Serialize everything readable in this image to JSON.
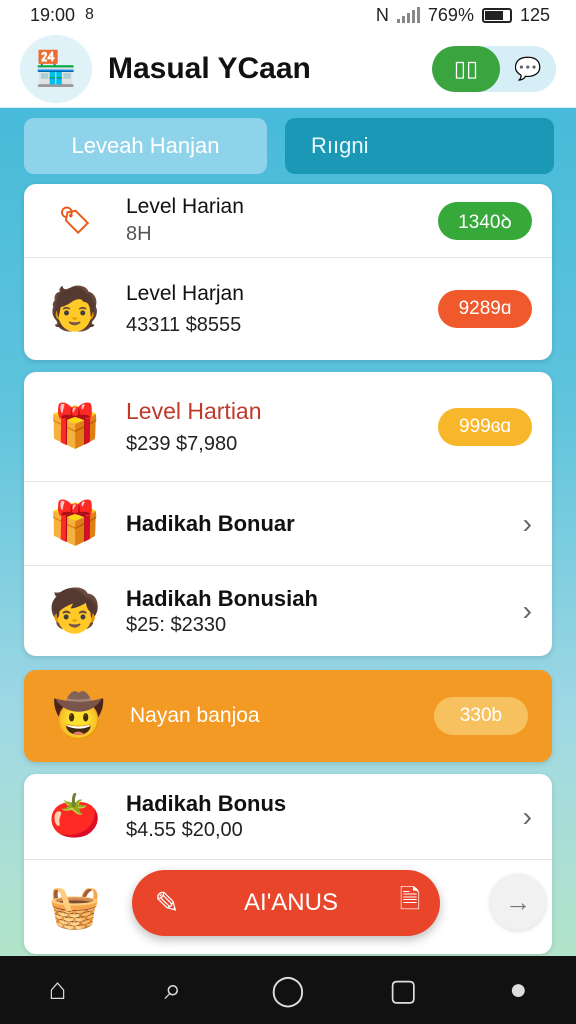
{
  "status": {
    "time": "19:00",
    "time_icon": "8",
    "battery": "769%",
    "right_clock": "125"
  },
  "header": {
    "title": "Masual YCaan",
    "logo_icon": "shop-stall-icon",
    "toggle_left_icon": "grid-icon",
    "toggle_right_icon": "chat-icon"
  },
  "tabs": [
    {
      "label": "Leveah Hanjan"
    },
    {
      "label": "Rııgni"
    }
  ],
  "card1": {
    "rows": [
      {
        "title": "Level Harian",
        "subtitle": "8H",
        "badge": "1340ꝺ",
        "thumb": "🏷"
      },
      {
        "title": "Level Harjan",
        "subtitle": "43311 $8555",
        "badge": "9289ɑ",
        "thumb": "🧑"
      }
    ]
  },
  "card2": {
    "rows": [
      {
        "title": "Level Hartian",
        "subtitle": "$239 $7,980",
        "badge": "999ɞɑ",
        "thumb": "🎁"
      },
      {
        "title": "Hadikah Bonuar",
        "subtitle": "",
        "thumb": "🎁"
      },
      {
        "title": "Hadikah Bonusiah",
        "subtitle": "$25: $2330",
        "thumb": "🧒"
      }
    ]
  },
  "promo": {
    "label": "Nayan banjoa",
    "badge": "330b",
    "thumb": "🤠"
  },
  "card3": {
    "rows": [
      {
        "title": "Hadikah Bonus",
        "subtitle": "$4.55 $20,00",
        "thumb": "🍅"
      },
      {
        "title": "",
        "subtitle": "",
        "thumb": "🧺"
      }
    ]
  },
  "fab": {
    "label": "AI'ANUS"
  },
  "colors": {
    "accent": "#3fb7d9",
    "green": "#37a93b",
    "orange": "#f0592c",
    "yellow": "#f8b62a",
    "promo": "#f39a25",
    "fab": "#e8452b"
  },
  "nav": {
    "home": "⌂",
    "search": "⌕",
    "circle": "◯",
    "square": "▢",
    "profile": "●"
  }
}
